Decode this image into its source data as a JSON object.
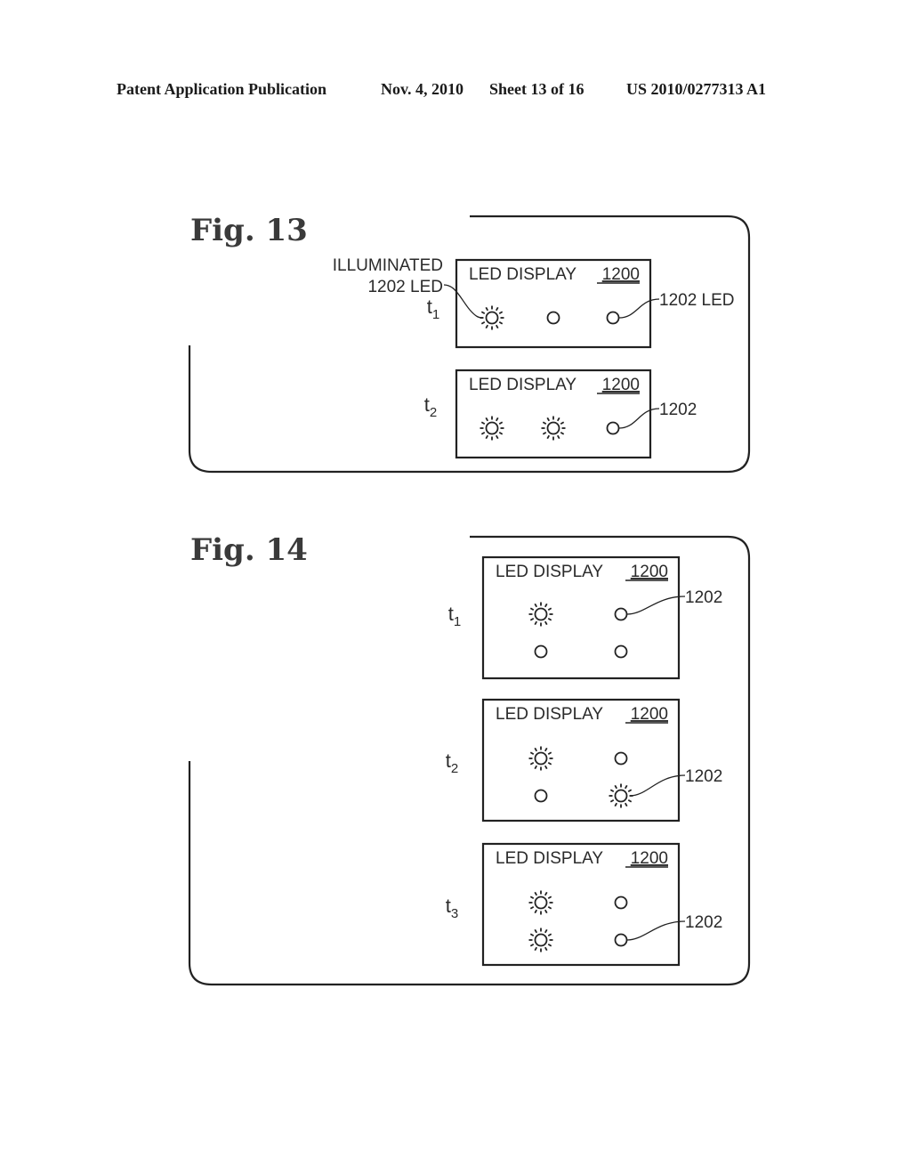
{
  "header": {
    "publication": "Patent Application Publication",
    "date": "Nov. 4, 2010",
    "sheet": "Sheet 13 of 16",
    "number": "US 2010/0277313 A1"
  },
  "figures": [
    {
      "id": "fig13",
      "title": "Fig. 13",
      "callout_left": {
        "line1": "ILLUMINATED",
        "line2": "1202 LED"
      },
      "panels": [
        {
          "time_label": "t",
          "time_sub": "1",
          "display_label": "LED DISPLAY",
          "display_ref": "1200",
          "grid": "1x3",
          "leds": [
            true,
            false,
            false
          ],
          "ref_label": "1202 LED",
          "ref_led_index": 2
        },
        {
          "time_label": "t",
          "time_sub": "2",
          "display_label": "LED DISPLAY",
          "display_ref": "1200",
          "grid": "1x3",
          "leds": [
            true,
            true,
            false
          ],
          "ref_label": "1202",
          "ref_led_index": 2
        }
      ]
    },
    {
      "id": "fig14",
      "title": "Fig. 14",
      "panels": [
        {
          "time_label": "t",
          "time_sub": "1",
          "display_label": "LED DISPLAY",
          "display_ref": "1200",
          "grid": "2x2",
          "leds": [
            true,
            false,
            false,
            false
          ],
          "ref_label": "1202",
          "ref_led_index": 1
        },
        {
          "time_label": "t",
          "time_sub": "2",
          "display_label": "LED DISPLAY",
          "display_ref": "1200",
          "grid": "2x2",
          "leds": [
            true,
            false,
            false,
            true
          ],
          "ref_label": "1202",
          "ref_led_index": 3
        },
        {
          "time_label": "t",
          "time_sub": "3",
          "display_label": "LED DISPLAY",
          "display_ref": "1200",
          "grid": "2x2",
          "leds": [
            true,
            false,
            true,
            false
          ],
          "ref_label": "1202",
          "ref_led_index": 3
        }
      ]
    }
  ]
}
